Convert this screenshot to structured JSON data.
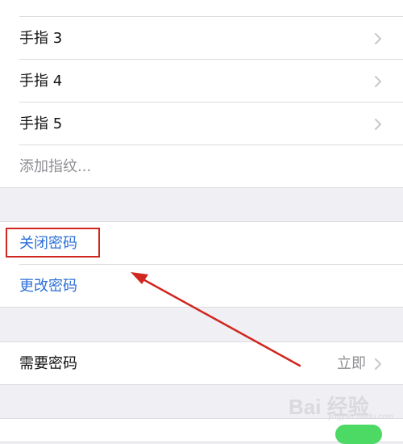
{
  "fingers": [
    {
      "label": "手指 3"
    },
    {
      "label": "手指 4"
    },
    {
      "label": "手指 5"
    }
  ],
  "add_fingerprint": "添加指纹...",
  "passcode": {
    "turn_off": "关闭密码",
    "change": "更改密码"
  },
  "require_passcode": {
    "label": "需要密码",
    "value": "立即"
  },
  "watermark": {
    "logo": "Bai 经验",
    "sub": "jingyan.baidu.com"
  },
  "colors": {
    "link_blue": "#2b6fd6",
    "annotation_red": "#d0271f",
    "toggle_green": "#4cd964"
  }
}
